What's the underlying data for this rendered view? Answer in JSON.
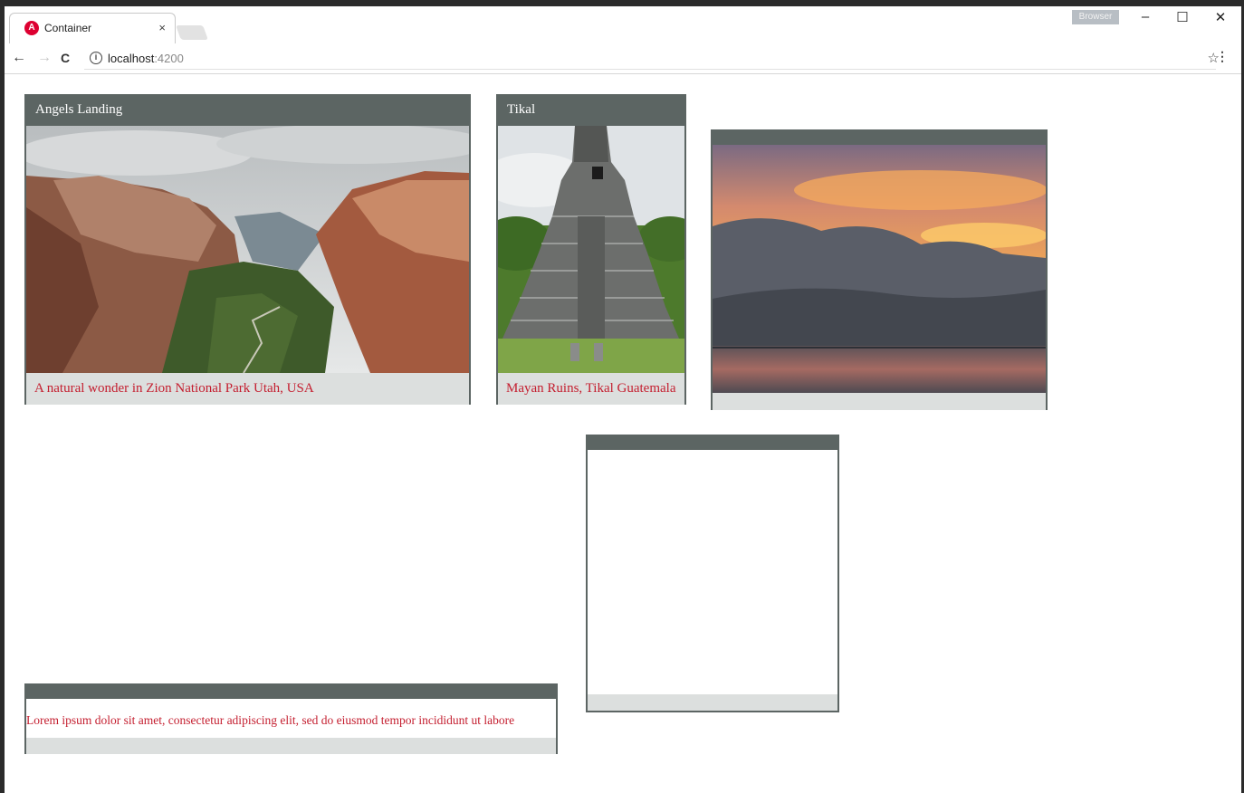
{
  "browser": {
    "tab_title": "Container",
    "tab_favicon_letter": "A",
    "tab_close": "×",
    "profile_badge": "Browser",
    "url_host": "localhost",
    "url_port": ":4200",
    "window_controls": {
      "minimize": "–",
      "maximize": "☐",
      "close": "✕"
    },
    "nav": {
      "back": "←",
      "forward": "→",
      "reload": "C"
    },
    "info_icon": "i",
    "star": "☆",
    "menu": "⋮"
  },
  "cards": [
    {
      "title": "Angels Landing",
      "image": "canyon-photo",
      "caption": "A natural wonder in Zion National Park Utah, USA"
    },
    {
      "title": "Tikal",
      "image": "pyramid-photo",
      "caption": "Mayan Ruins, Tikal Guatemala"
    },
    {
      "title": "",
      "image": "sunset-photo",
      "caption": ""
    },
    {
      "title": "",
      "image": "",
      "caption": ""
    },
    {
      "title": "",
      "image": "",
      "caption": "Lorem ipsum dolor sit amet, consectetur adipiscing elit, sed do eiusmod tempor incididunt ut labore"
    }
  ],
  "colors": {
    "header": "#5c6563",
    "footer": "#dcdfde",
    "caption_text": "#c41e2f",
    "angular_red": "#dd0031"
  }
}
